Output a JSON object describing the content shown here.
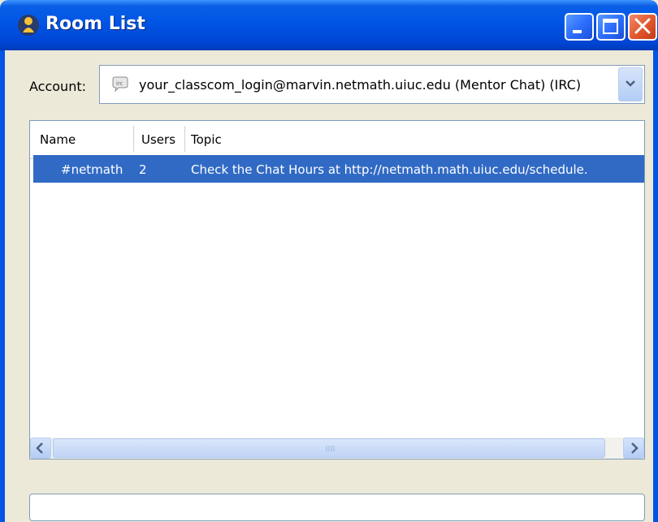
{
  "window": {
    "title": "Room List"
  },
  "account": {
    "label": "Account:",
    "value": "your_classcom_login@marvin.netmath.uiuc.edu (Mentor Chat) (IRC)"
  },
  "room_list": {
    "columns": [
      "Name",
      "Users",
      "Topic"
    ],
    "rows": [
      {
        "name": "#netmath",
        "users": "2",
        "topic": "Check the Chat Hours at http://netmath.math.uiuc.edu/schedule."
      }
    ]
  },
  "status_field": {
    "value": ""
  }
}
